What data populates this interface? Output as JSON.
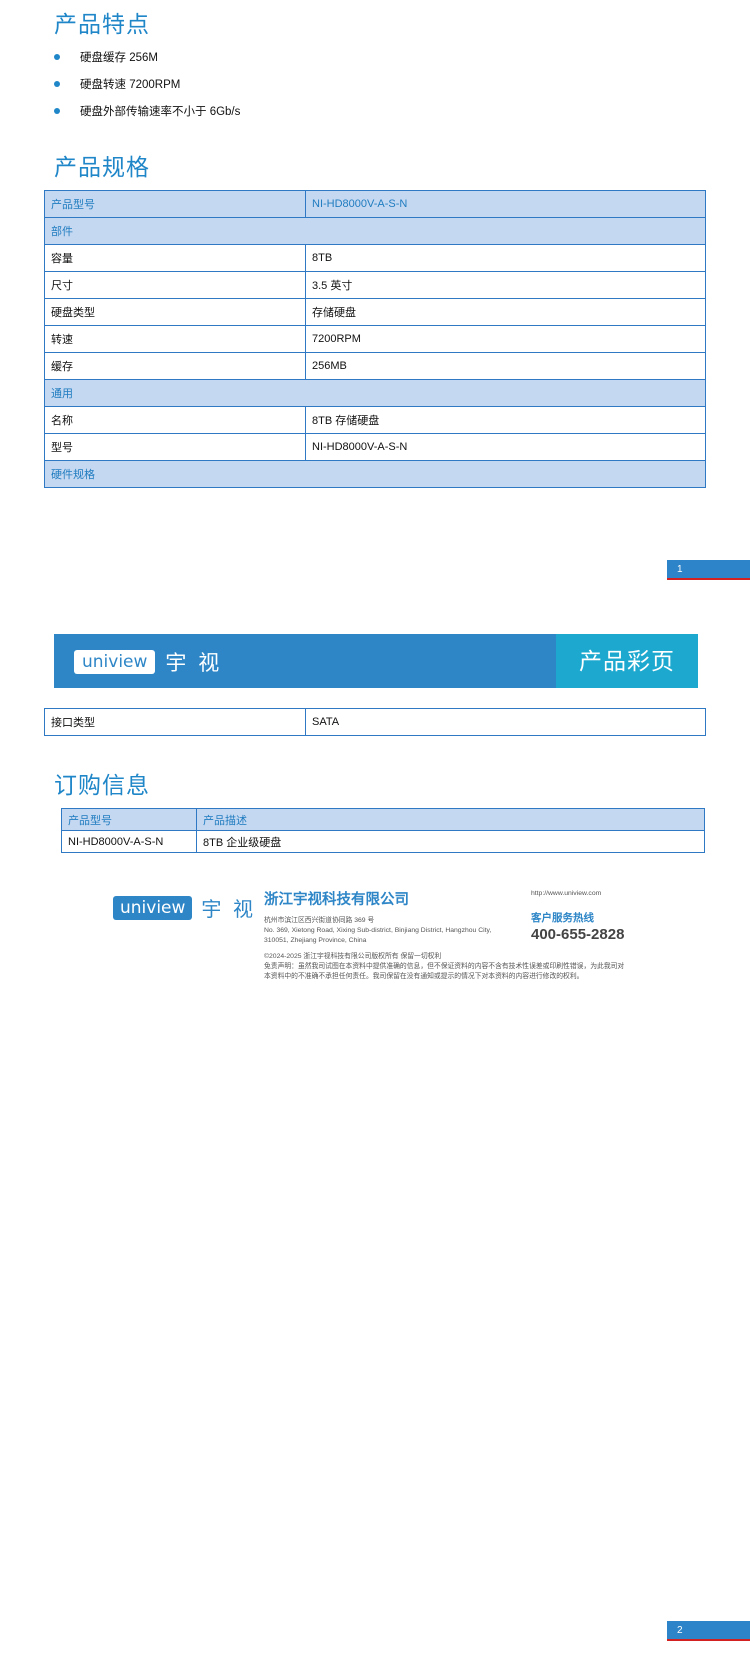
{
  "features": {
    "title": "产品特点",
    "items": [
      "硬盘缓存 256M",
      "硬盘转速 7200RPM",
      "硬盘外部传输速率不小于 6Gb/s"
    ]
  },
  "specs": {
    "title": "产品规格",
    "header_key": "产品型号",
    "header_val": "NI-HD8000V-A-S-N",
    "section_parts": "部件",
    "parts": [
      {
        "k": "容量",
        "v": "8TB"
      },
      {
        "k": "尺寸",
        "v": "3.5 英寸"
      },
      {
        "k": "硬盘类型",
        "v": "存储硬盘"
      },
      {
        "k": "转速",
        "v": "7200RPM"
      },
      {
        "k": "缓存",
        "v": "256MB"
      }
    ],
    "section_general": "通用",
    "general": [
      {
        "k": "名称",
        "v": "8TB 存储硬盘"
      },
      {
        "k": "型号",
        "v": "NI-HD8000V-A-S-N"
      }
    ],
    "section_hw": "硬件规格",
    "hw": [
      {
        "k": "接口类型",
        "v": "SATA"
      }
    ]
  },
  "page1": "1",
  "page2": "2",
  "banner": {
    "logo": "uniview",
    "logo_cn": "宇 视",
    "right": "产品彩页"
  },
  "order": {
    "title": "订购信息",
    "h1": "产品型号",
    "h2": "产品描述",
    "c1": "NI-HD8000V-A-S-N",
    "c2": "8TB 企业级硬盘"
  },
  "footer": {
    "logo": "uniview",
    "logo_cn": "宇 视",
    "company": "浙江宇视科技有限公司",
    "addr_cn": "杭州市滨江区西兴街道协同路 369 号",
    "addr_en1": "No. 369, Xietong Road, Xixing Sub-district, Binjiang District, Hangzhou City,",
    "addr_en2": "310051, Zhejiang Province, China",
    "url": "http://www.uniview.com",
    "hotline_label": "客户服务热线",
    "hotline": "400-655-2828",
    "copyright": "©2024-2025  浙江宇视科技有限公司版权所有  保留一切权利",
    "disclaimer1": "免责声明：虽然我司试图在本资料中提供准确的信息，但不保证资料的内容不含有技术性误差或印刷性错误，为此我司对",
    "disclaimer2": "本资料中的不准确不承担任何责任。我司保留在没有通知或提示的情况下对本资料的内容进行修改的权利。"
  }
}
